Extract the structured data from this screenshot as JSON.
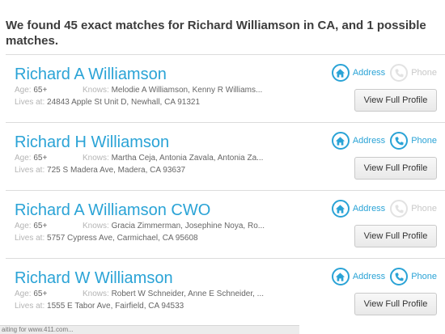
{
  "header": {
    "text": "We found 45 exact matches for Richard Williamson in CA, and 1 possible matches."
  },
  "labels": {
    "age": "Age:",
    "knows": "Knows:",
    "lives_at": "Lives at:",
    "address": "Address",
    "phone": "Phone",
    "view_profile": "View Full Profile"
  },
  "results": [
    {
      "name": "Richard A Williamson",
      "age": "65+",
      "knows": "Melodie A Williamson, Kenny R Williams...",
      "lives_at": "24843 Apple St Unit D, Newhall, CA 91321",
      "phone_available": false
    },
    {
      "name": "Richard H Williamson",
      "age": "65+",
      "knows": "Martha Ceja, Antonia Zavala, Antonia Za...",
      "lives_at": "725 S Madera Ave, Madera, CA 93637",
      "phone_available": true
    },
    {
      "name": "Richard A Williamson CWO",
      "age": "65+",
      "knows": "Gracia Zimmerman, Josephine Noya, Ro...",
      "lives_at": "5757 Cypress Ave, Carmichael, CA 95608",
      "phone_available": false
    },
    {
      "name": "Richard W Williamson",
      "age": "65+",
      "knows": "Robert W Schneider, Anne E Schneider, ...",
      "lives_at": "1555 E Tabor Ave, Fairfield, CA 94533",
      "phone_available": true
    }
  ],
  "status_bar": {
    "text": "aiting for www.411.com..."
  },
  "colors": {
    "accent": "#2aa3d6",
    "disabled": "#e2e2e2"
  },
  "icons": {
    "address": "home-icon",
    "phone": "phone-icon"
  }
}
